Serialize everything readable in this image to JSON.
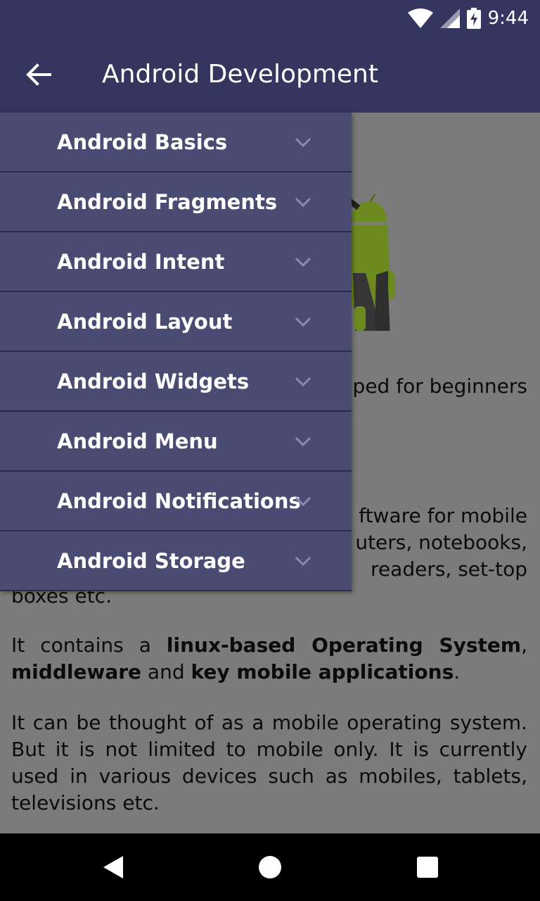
{
  "status_bar": {
    "time": "9:44",
    "icons": [
      "wifi-icon",
      "signal-icon",
      "battery-charging-icon"
    ]
  },
  "app_bar": {
    "title": "Android Development",
    "back_icon": "arrow-back-icon"
  },
  "drawer": {
    "items": [
      {
        "label": "Android Basics"
      },
      {
        "label": "Android Fragments"
      },
      {
        "label": "Android Intent"
      },
      {
        "label": "Android Layout"
      },
      {
        "label": "Android Widgets"
      },
      {
        "label": "Android Menu"
      },
      {
        "label": "Android Notifications"
      },
      {
        "label": "Android Storage"
      }
    ],
    "chevron_icon": "chevron-down-icon"
  },
  "content": {
    "p1": "overs basic and technology. Our ped for beginners",
    "p2_a": "ftware for mobile",
    "p2_b": "uters, notebooks,",
    "p2_c": "readers, set-top",
    "p2_d": "boxes etc.",
    "p3_pre": "It contains a ",
    "p3_b1": "linux-based Operating System",
    "p3_mid1": ", ",
    "p3_b2": "middleware",
    "p3_mid2": " and ",
    "p3_b3": "key mobile applications",
    "p3_end": ".",
    "p4": "It can be thought of as a mobile operating system. But it is not limited to mobile only. It is currently used in various devices such as mobiles, tablets, televisions etc."
  },
  "nav_bar": {
    "icons": [
      "back-triangle-icon",
      "home-circle-icon",
      "recents-square-icon"
    ]
  },
  "colors": {
    "app_bar": "#35365f",
    "drawer": "#4a4b72",
    "scrim": "#7b7b7b"
  }
}
